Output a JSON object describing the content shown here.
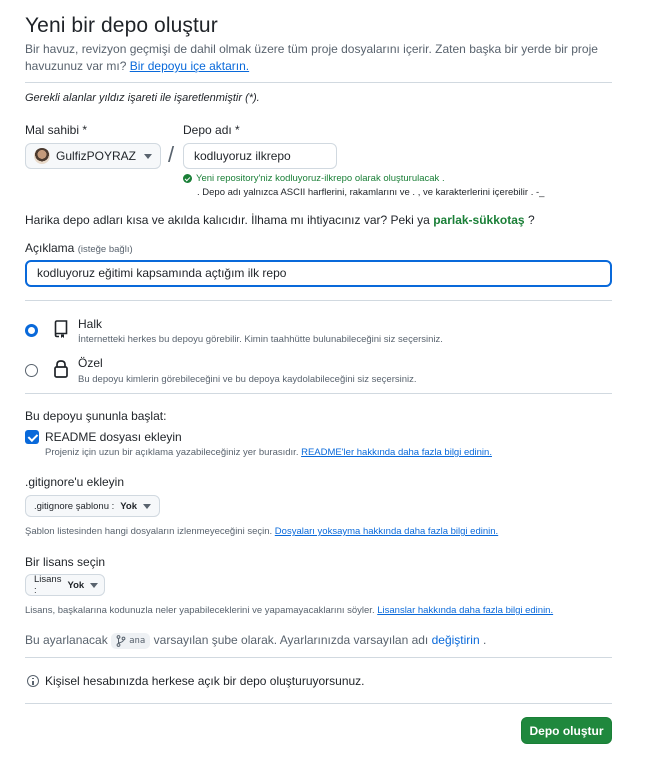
{
  "page": {
    "title": "Yeni bir depo oluştur",
    "intro_text": "Bir havuz, revizyon geçmişi de dahil olmak üzere tüm proje dosyalarını içerir. Zaten başka bir yerde bir proje havuzunuz var mı?",
    "intro_link": "Bir depoyu içe aktarın.",
    "required_note": "Gerekli alanlar yıldız işareti ile işaretlenmiştir (*)."
  },
  "owner": {
    "label": "Mal sahibi *",
    "value": "GulfizPOYRAZ"
  },
  "separator": "/",
  "repo": {
    "label": "Depo adı *",
    "value": "kodluyoruz ilkrepo",
    "available_msg": "Yeni repository'niz kodluyoruz-ilkrepo olarak oluşturulacak .",
    "ascii_msg": ". Depo adı yalnızca ASCII harflerini, rakamlarını ve . , ve karakterlerini içerebilir . -_"
  },
  "tip": {
    "text": "Harika depo adları kısa ve akılda kalıcıdır. İlhama mı ihtiyacınız var? Peki ya",
    "suggestion": "parlak-sükkotaş",
    "suffix": "?"
  },
  "description": {
    "label": "Açıklama",
    "optional": "(isteğe bağlı)",
    "value": "kodluyoruz eğitimi kapsamında açtığım ilk repo"
  },
  "visibility": {
    "public": {
      "title": "Halk",
      "desc": "İnternetteki herkes bu depoyu görebilir. Kimin taahhütte bulunabileceğini siz seçersiniz.",
      "selected": true
    },
    "private": {
      "title": "Özel",
      "desc": "Bu depoyu kimlerin görebileceğini ve bu depoya kaydolabileceğini siz seçersiniz.",
      "selected": false
    }
  },
  "init": {
    "heading": "Bu depoyu şununla başlat:",
    "readme_label": "README dosyası ekleyin",
    "readme_checked": true,
    "readme_desc": "Projeniz için uzun bir açıklama yazabileceğiniz yer burasıdır.",
    "readme_link": "README'ler hakkında daha fazla bilgi edinin."
  },
  "gitignore": {
    "heading": ".gitignore'u ekleyin",
    "select_prefix": ".gitignore şablonu :",
    "select_value": "Yok",
    "desc": "Şablon listesinden hangi dosyaların izlenmeyeceğini seçin.",
    "link": "Dosyaları yoksayma hakkında daha fazla bilgi edinin."
  },
  "license": {
    "heading": "Bir lisans seçin",
    "select_prefix": "Lisans :",
    "select_value": "Yok",
    "desc": "Lisans, başkalarına kodunuzla neler yapabileceklerini ve yapamayacaklarını söyler.",
    "link": "Lisanslar hakkında daha fazla bilgi edinin."
  },
  "branch_note": {
    "prefix": "Bu ayarlanacak",
    "branch": "ana",
    "middle": "varsayılan şube olarak. Ayarlarınızda varsayılan adı",
    "link": "değiştirin",
    "suffix": "."
  },
  "info": {
    "text": "Kişisel hesabınızda herkese açık bir depo oluşturuyorsunuz."
  },
  "submit": {
    "label": "Depo oluştur"
  },
  "colors": {
    "accent": "#0969da",
    "success": "#1a7f37",
    "button_green": "#1f883d"
  }
}
